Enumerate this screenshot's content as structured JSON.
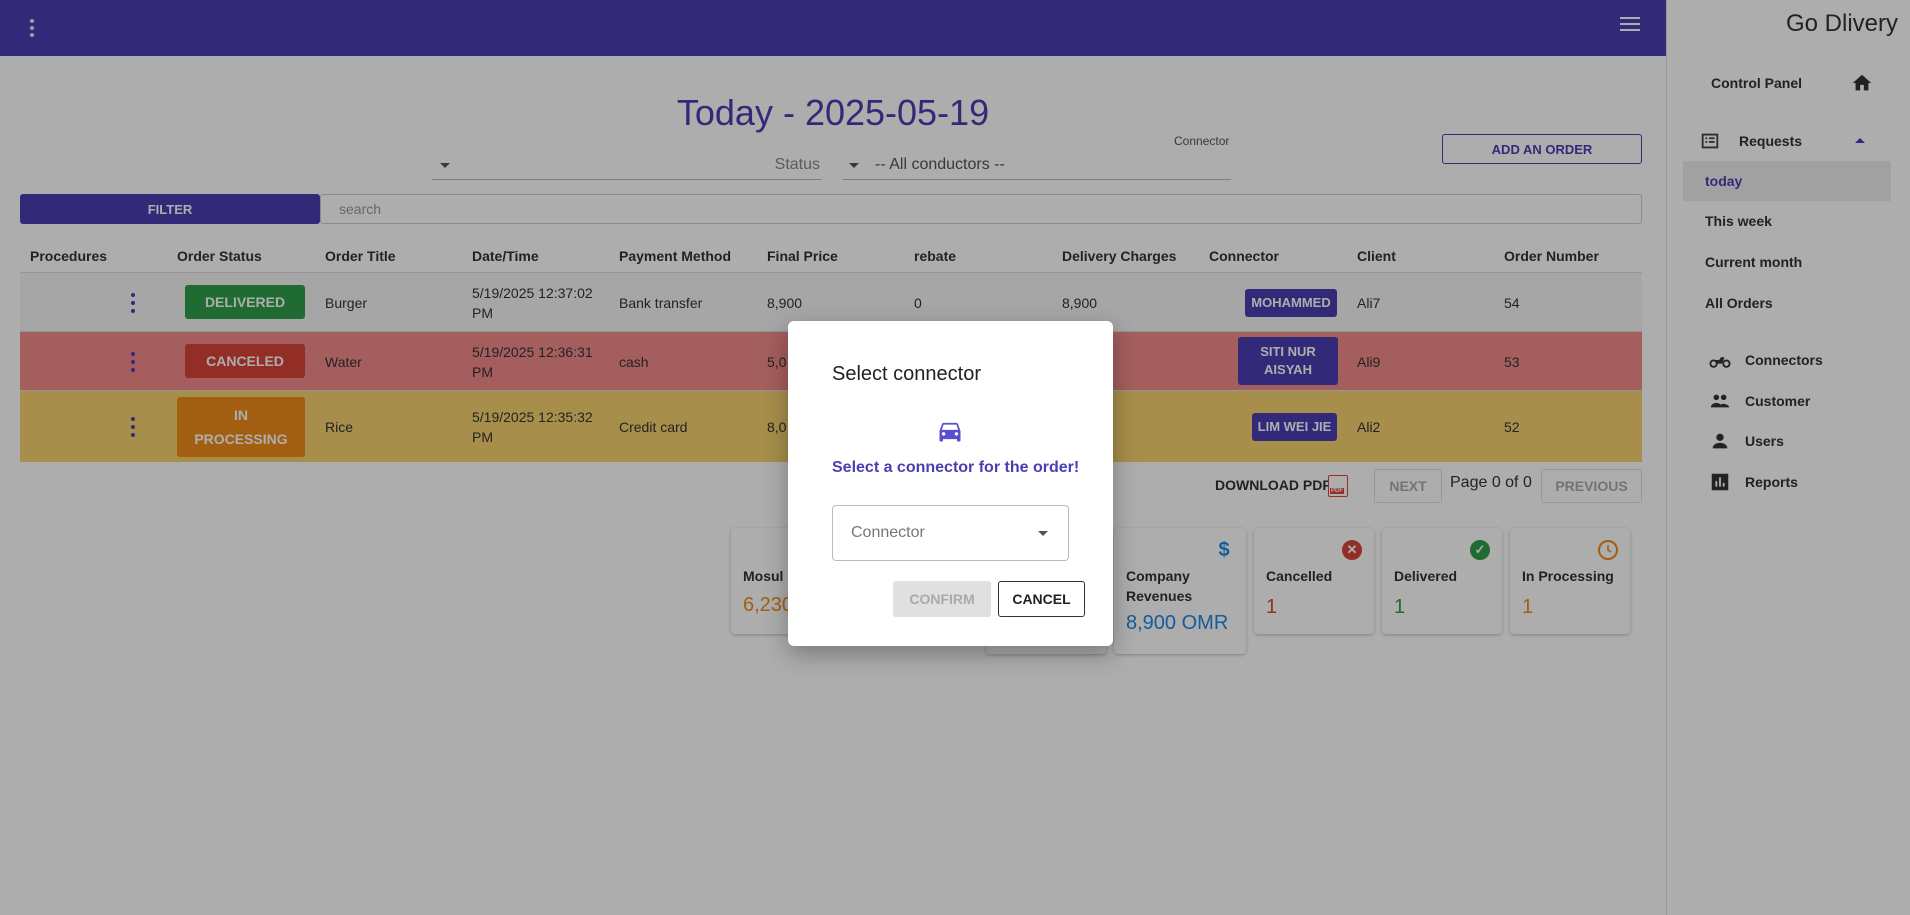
{
  "header": {
    "menu_icon": "kebab-icon",
    "hamburger_icon": "hamburger-icon"
  },
  "sidebar": {
    "brand": "Go Dlivery",
    "control_panel": "Control Panel",
    "requests": "Requests",
    "sub_items": [
      "today",
      "This week",
      "Current month",
      "All Orders"
    ],
    "active_sub_item": "today",
    "items": [
      "Connectors",
      "Customer",
      "Users",
      "Reports"
    ]
  },
  "page": {
    "title": "Today - 2025-05-19",
    "status_label": "Status",
    "connector_label": "Connector",
    "connector_value": "-- All conductors --",
    "add_order": "ADD AN ORDER",
    "filter": "FILTER",
    "search_placeholder": "search"
  },
  "table": {
    "headers": [
      "Procedures",
      "Order Status",
      "Order Title",
      "Date/Time",
      "Payment Method",
      "Final Price",
      "rebate",
      "Delivery Charges",
      "Connector",
      "Client",
      "Order Number"
    ],
    "rows": [
      {
        "status": "DELIVERED",
        "title": "Burger",
        "datetime": "5/19/2025 12:37:02 PM",
        "payment": "Bank transfer",
        "final_price": "8,900",
        "rebate": "0",
        "delivery": "8,900",
        "connector": "MOHAMMED",
        "client": "Ali7",
        "order_number": "54",
        "row_color": "#f5f5f5",
        "status_color": "#2e9e4a"
      },
      {
        "status": "CANCELED",
        "title": "Water",
        "datetime": "5/19/2025 12:36:31 PM",
        "payment": "cash",
        "final_price": "5,0",
        "rebate": "",
        "delivery": "",
        "connector": "SITI NUR AISYAH",
        "client": "Ali9",
        "order_number": "53",
        "row_color": "#f28b8b",
        "status_color": "#d9443a"
      },
      {
        "status": "IN PROCESSING",
        "title": "Rice",
        "datetime": "5/19/2025 12:35:32 PM",
        "payment": "Credit card",
        "final_price": "8,0",
        "rebate": "",
        "delivery": "",
        "connector": "LIM WEI JIE",
        "client": "Ali2",
        "order_number": "52",
        "row_color": "#f7d26e",
        "status_color": "#f08c1a"
      }
    ]
  },
  "pagination": {
    "download_pdf": "DOWNLOAD PDF",
    "pdf_badge": "PDF",
    "next": "NEXT",
    "page_text": "Page 0 of 0",
    "previous": "PREVIOUS"
  },
  "stats": {
    "mosul_label": "Mosul R",
    "mosul_value": "6,230",
    "company_label": "Company Revenues",
    "company_value": "8,900 OMR",
    "cancelled_label": "Cancelled",
    "cancelled_value": "1",
    "delivered_label": "Delivered",
    "delivered_value": "1",
    "processing_label": "In Processing",
    "processing_value": "1"
  },
  "dialog": {
    "title": "Select connector",
    "icon": "car-icon",
    "message": "Select a connector for the order!",
    "select_placeholder": "Connector",
    "confirm": "CONFIRM",
    "cancel": "CANCEL"
  },
  "colors": {
    "primary": "#4a3fb2",
    "delivered": "#2e9e4a",
    "canceled": "#d9443a",
    "processing": "#f08c1a",
    "revenue": "#1e88e5"
  }
}
